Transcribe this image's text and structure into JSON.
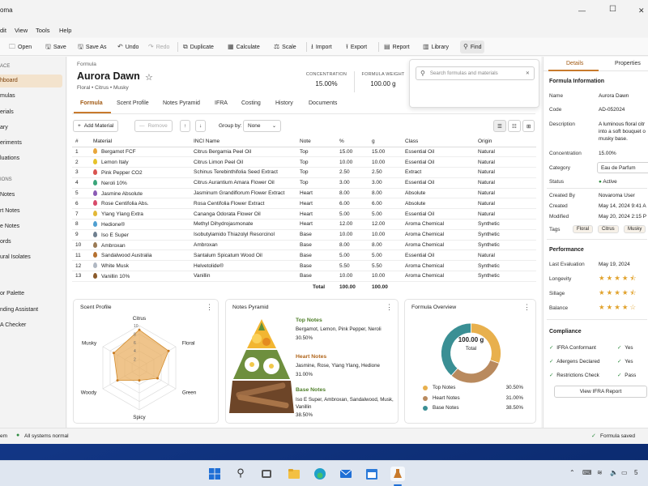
{
  "window": {
    "title": "oma"
  },
  "menu": [
    "dit",
    "View",
    "Tools",
    "Help"
  ],
  "toolbar": {
    "open": "Open",
    "save": "Save",
    "save_as": "Save As",
    "undo": "Undo",
    "redo": "Redo",
    "duplicate": "Duplicate",
    "calculate": "Calculate",
    "scale": "Scale",
    "import": "Import",
    "export": "Export",
    "report": "Report",
    "library": "Library",
    "find": "Find"
  },
  "sidebar": {
    "section1": "ACE",
    "items1": [
      "hboard",
      "mulas",
      "erials",
      "ary",
      "eriments",
      "luations"
    ],
    "section2": "IONS",
    "items2": [
      "Notes",
      "rt Notes",
      "e Notes",
      "ords",
      "ural Isolates"
    ],
    "items3": [
      "or Palette",
      "nding Assistant",
      "A Checker"
    ]
  },
  "formula": {
    "breadcrumb": "Formula",
    "title": "Aurora Dawn",
    "subtitle": "Floral • Citrus • Musky",
    "concentration_label": "CONCENTRATION",
    "concentration": "15.00%",
    "weight_label": "FORMULA WEIGHT",
    "weight": "100.00 g"
  },
  "search": {
    "placeholder": "Search formulas and materials"
  },
  "tabs": [
    "Formula",
    "Scent Profile",
    "Notes Pyramid",
    "IFRA",
    "Costing",
    "History",
    "Documents"
  ],
  "actions": {
    "add": "Add Material",
    "remove": "Remove",
    "group_by": "Group by:",
    "group_value": "None"
  },
  "table": {
    "headers": [
      "#",
      "Material",
      "INCI Name",
      "Note",
      "%",
      "g",
      "Class",
      "Origin"
    ],
    "rows": [
      {
        "n": "1",
        "material": "Bergamot FCF",
        "inci": "Citrus Bergamia Peel Oil",
        "note": "Top",
        "pct": "15.00",
        "g": "15.00",
        "cls": "Essential Oil",
        "origin": "Natural",
        "color": "#e8a63a"
      },
      {
        "n": "2",
        "material": "Lemon Italy",
        "inci": "Citrus Limon Peel Oil",
        "note": "Top",
        "pct": "10.00",
        "g": "10.00",
        "cls": "Essential Oil",
        "origin": "Natural",
        "color": "#e6c229"
      },
      {
        "n": "3",
        "material": "Pink Pepper CO2",
        "inci": "Schinus Terebinthifolia Seed Extract",
        "note": "Top",
        "pct": "2.50",
        "g": "2.50",
        "cls": "Extract",
        "origin": "Natural",
        "color": "#d9534f"
      },
      {
        "n": "4",
        "material": "Neroli 10%",
        "inci": "Citrus Aurantium Amara Flower Oil",
        "note": "Top",
        "pct": "3.00",
        "g": "3.00",
        "cls": "Essential Oil",
        "origin": "Natural",
        "color": "#3aa57a"
      },
      {
        "n": "5",
        "material": "Jasmine Absolute",
        "inci": "Jasminum Grandiflorum Flower Extract",
        "note": "Heart",
        "pct": "8.00",
        "g": "8.00",
        "cls": "Absolute",
        "origin": "Natural",
        "color": "#8a5bb5"
      },
      {
        "n": "6",
        "material": "Rose Centifolia Abs.",
        "inci": "Rosa Centifolia Flower Extract",
        "note": "Heart",
        "pct": "6.00",
        "g": "6.00",
        "cls": "Absolute",
        "origin": "Natural",
        "color": "#d84b6a"
      },
      {
        "n": "7",
        "material": "Ylang Ylang Extra",
        "inci": "Cananga Odorata Flower Oil",
        "note": "Heart",
        "pct": "5.00",
        "g": "5.00",
        "cls": "Essential Oil",
        "origin": "Natural",
        "color": "#e3b836"
      },
      {
        "n": "8",
        "material": "Hedione®",
        "inci": "Methyl Dihydrojasmonate",
        "note": "Heart",
        "pct": "12.00",
        "g": "12.00",
        "cls": "Aroma Chemical",
        "origin": "Synthetic",
        "color": "#4f9fd1"
      },
      {
        "n": "9",
        "material": "Iso E Super",
        "inci": "Isobutylamido Thiazolyl Resorcinol",
        "note": "Base",
        "pct": "10.00",
        "g": "10.00",
        "cls": "Aroma Chemical",
        "origin": "Synthetic",
        "color": "#6f7f8f"
      },
      {
        "n": "10",
        "material": "Ambroxan",
        "inci": "Ambroxan",
        "note": "Base",
        "pct": "8.00",
        "g": "8.00",
        "cls": "Aroma Chemical",
        "origin": "Synthetic",
        "color": "#9a7a55"
      },
      {
        "n": "11",
        "material": "Sandalwood Australia",
        "inci": "Santalum Spicatum Wood Oil",
        "note": "Base",
        "pct": "5.00",
        "g": "5.00",
        "cls": "Essential Oil",
        "origin": "Natural",
        "color": "#b5702f"
      },
      {
        "n": "12",
        "material": "White Musk",
        "inci": "Helvetolide®",
        "note": "Base",
        "pct": "5.50",
        "g": "5.50",
        "cls": "Aroma Chemical",
        "origin": "Synthetic",
        "color": "#b0b8c3"
      },
      {
        "n": "13",
        "material": "Vanillin 10%",
        "inci": "Vanillin",
        "note": "Base",
        "pct": "10.00",
        "g": "10.00",
        "cls": "Aroma Chemical",
        "origin": "Synthetic",
        "color": "#8a5a2b"
      }
    ],
    "total_label": "Total",
    "total_pct": "100.00",
    "total_g": "100.00"
  },
  "scent_profile": {
    "title": "Scent Profile",
    "axes": [
      "Citrus",
      "Floral",
      "Green",
      "Spicy",
      "Woody",
      "Musky"
    ],
    "values": [
      9,
      8,
      5,
      3,
      6,
      7
    ],
    "ticks": [
      "2",
      "4",
      "6",
      "8",
      "10"
    ],
    "max": 10,
    "color": "#e9b064"
  },
  "pyramid": {
    "title": "Notes Pyramid",
    "tiers": [
      {
        "name": "Top Notes",
        "materials": "Bergamot, Lemon, Pink Pepper, Neroli",
        "pct": "30.50%"
      },
      {
        "name": "Heart Notes",
        "materials": "Jasmine, Rose, Ylang Ylang, Hedione",
        "pct": "31.00%"
      },
      {
        "name": "Base Notes",
        "materials": "Iso E Super, Ambroxan, Sandalwood, Musk, Vanillin",
        "pct": "38.50%"
      }
    ]
  },
  "overview": {
    "title": "Formula Overview",
    "center_value": "100.00 g",
    "center_label": "Total",
    "segments": [
      {
        "name": "Top Notes",
        "pct": "30.50%",
        "value": 30.5,
        "color": "#e8b04d"
      },
      {
        "name": "Heart Notes",
        "pct": "31.00%",
        "value": 31.0,
        "color": "#b98a5e"
      },
      {
        "name": "Base Notes",
        "pct": "38.50%",
        "value": 38.5,
        "color": "#3a8f94"
      }
    ]
  },
  "details": {
    "tab_details": "Details",
    "tab_properties": "Properties",
    "section": "Formula Information",
    "name_label": "Name",
    "name": "Aurora Dawn",
    "code_label": "Code",
    "code": "AD-052024",
    "desc_label": "Description",
    "desc_lines": [
      "A luminous floral citr",
      "into a soft bouquet o",
      "musky base."
    ],
    "conc_label": "Concentration",
    "conc": "15.00%",
    "cat_label": "Category",
    "cat": "Eau de Parfum",
    "status_label": "Status",
    "status": "Active",
    "created_by_label": "Created By",
    "created_by": "Novaroma User",
    "created_label": "Created",
    "created": "May 14, 2024  9:41 A",
    "modified_label": "Modified",
    "modified": "May 20, 2024  2:15 P",
    "tags_label": "Tags",
    "tags": [
      "Floral",
      "Citrus",
      "Musky"
    ],
    "perf_section": "Performance",
    "last_eval_label": "Last Evaluation",
    "last_eval": "May 19, 2024",
    "longevity_label": "Longevity",
    "longevity": 4.5,
    "sillage_label": "Sillage",
    "sillage": 4.5,
    "balance_label": "Balance",
    "balance": 4,
    "comp_section": "Compliance",
    "comp": [
      {
        "label": "IFRA Conformant",
        "value": "Yes"
      },
      {
        "label": "Allergens Declared",
        "value": "Yes"
      },
      {
        "label": "Restrictions Check",
        "value": "Pass"
      }
    ],
    "ifra_button": "View IFRA Report"
  },
  "status": {
    "left": "em",
    "systems": "All systems normal",
    "saved": "Formula saved"
  },
  "tray": {
    "time": "5"
  }
}
